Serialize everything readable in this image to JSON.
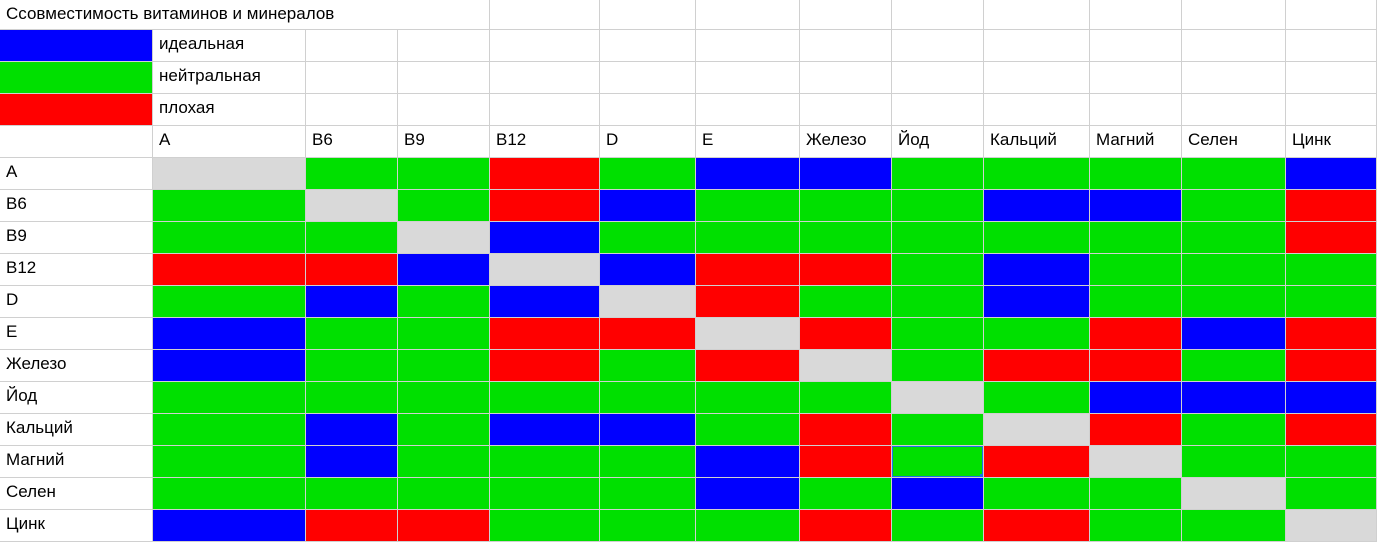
{
  "colors": {
    "ideal": "#0000ff",
    "neutral": "#00e000",
    "bad": "#ff0000",
    "self": "#d9d9d9",
    "blank": "#ffffff"
  },
  "title": "Ссовместимость витаминов и минералов",
  "legend": [
    {
      "color_key": "ideal",
      "label": "идеальная"
    },
    {
      "color_key": "neutral",
      "label": "нейтральная"
    },
    {
      "color_key": "bad",
      "label": "плохая"
    }
  ],
  "chart_data": {
    "type": "heatmap",
    "title": "Ссовместимость витаминов и минералов",
    "categories": [
      "A",
      "B6",
      "B9",
      "B12",
      "D",
      "E",
      "Железо",
      "Йод",
      "Кальций",
      "Магний",
      "Селен",
      "Цинк"
    ],
    "value_legend": {
      "1": "идеальная",
      "0": "нейтральная",
      "-1": "плохая",
      "null": "—"
    },
    "matrix": [
      [
        null,
        0,
        0,
        -1,
        0,
        1,
        1,
        0,
        0,
        0,
        0,
        1
      ],
      [
        0,
        null,
        0,
        -1,
        1,
        0,
        0,
        0,
        1,
        1,
        0,
        -1
      ],
      [
        0,
        0,
        null,
        1,
        0,
        0,
        0,
        0,
        0,
        0,
        0,
        -1
      ],
      [
        -1,
        -1,
        1,
        null,
        1,
        -1,
        -1,
        0,
        1,
        0,
        0,
        0
      ],
      [
        0,
        1,
        0,
        1,
        null,
        -1,
        0,
        0,
        1,
        0,
        0,
        0
      ],
      [
        1,
        0,
        0,
        -1,
        -1,
        null,
        -1,
        0,
        0,
        -1,
        1,
        -1
      ],
      [
        1,
        0,
        0,
        -1,
        0,
        -1,
        null,
        0,
        -1,
        -1,
        0,
        -1
      ],
      [
        0,
        0,
        0,
        0,
        0,
        0,
        0,
        null,
        0,
        1,
        1,
        1
      ],
      [
        0,
        1,
        0,
        1,
        1,
        0,
        -1,
        0,
        null,
        -1,
        0,
        -1
      ],
      [
        0,
        1,
        0,
        0,
        0,
        1,
        -1,
        0,
        -1,
        null,
        0,
        0
      ],
      [
        0,
        0,
        0,
        0,
        0,
        1,
        0,
        1,
        0,
        0,
        null,
        0
      ],
      [
        1,
        -1,
        -1,
        0,
        0,
        0,
        -1,
        0,
        -1,
        0,
        0,
        null
      ]
    ]
  },
  "selected_cell": {
    "row": 9,
    "col": 7
  }
}
